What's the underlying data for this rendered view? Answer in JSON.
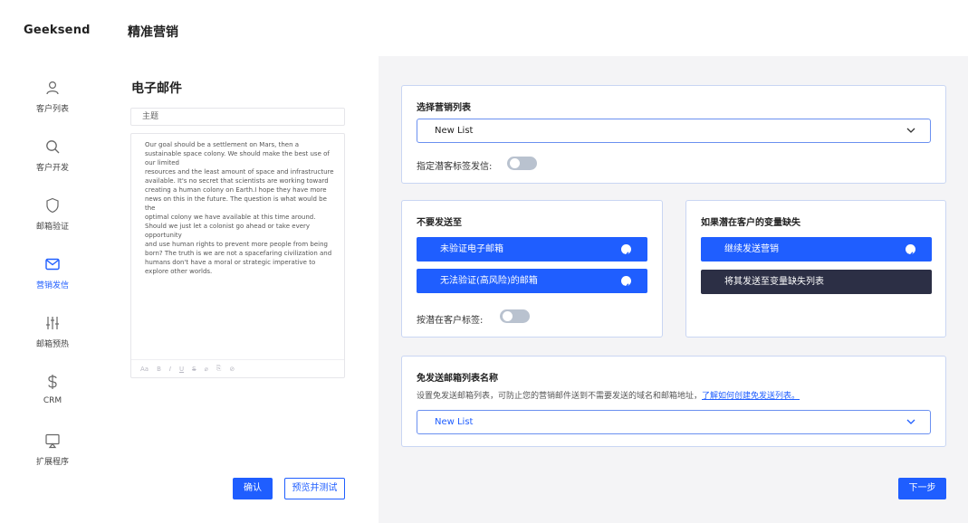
{
  "app": {
    "brand": "Geeksend",
    "page_title": "精准营销"
  },
  "sidebar": {
    "items": [
      {
        "label": "客户列表",
        "icon": "user-icon"
      },
      {
        "label": "客户开发",
        "icon": "search-icon"
      },
      {
        "label": "邮箱验证",
        "icon": "shield-icon"
      },
      {
        "label": "营销发信",
        "icon": "mail-icon",
        "active": true
      },
      {
        "label": "邮箱预热",
        "icon": "sliders-icon"
      },
      {
        "label": "CRM",
        "icon": "dollar-icon"
      },
      {
        "label": "扩展程序",
        "icon": "monitor-icon"
      }
    ]
  },
  "editor": {
    "title": "电子邮件",
    "subject_placeholder": "主题",
    "body": "Our goal should be a settlement on Mars, then a\nsustainable space colony. We should make the best use of\nour limited\nresources and the least amount of space and infrastructure\navailable. It's no secret that scientists are working toward\ncreating a human colony on Earth.I hope they have more\nnews on this in the future. The question is what would be\nthe\noptimal colony we have available at this time around.\nShould we just let a colonist go ahead or take every\nopportunity\nand use human rights to prevent more people from being\nborn? The truth is we are not a spacefaring civilization and\nhumans don't have a moral or strategic imperative to\nexplore other worlds.",
    "toolbar": [
      "Aa",
      "B",
      "I",
      "U",
      "S",
      "⌀",
      "⎘",
      "⊘"
    ],
    "confirm_label": "确认",
    "preview_label": "预览并测试"
  },
  "settings": {
    "list_section": {
      "title": "选择营销列表",
      "selected": "New List",
      "toggle_label": "指定潜客标签发信:",
      "toggle_on": false
    },
    "exclude_section": {
      "title": "不要发送至",
      "options": [
        "未验证电子邮箱",
        "无法验证(高风险)的邮箱"
      ],
      "toggle_label": "按潜在客户标签:",
      "toggle_on": false
    },
    "missing_section": {
      "title": "如果潜在客户的变量缺失",
      "options": [
        "继续发送营销",
        "将其发送至变量缺失列表"
      ]
    },
    "suppression_section": {
      "title": "免发送邮箱列表名称",
      "description": "设置免发送邮箱列表，可防止您的营销邮件送到不需要发送的域名和邮箱地址，",
      "link": "了解如何创建免发送列表。",
      "selected": "New List"
    },
    "next_label": "下一步"
  },
  "colors": {
    "accent": "#1f5eff",
    "dark": "#2c2f45",
    "panel_bg": "#f4f4f6",
    "card_border": "#c9d6f3"
  }
}
